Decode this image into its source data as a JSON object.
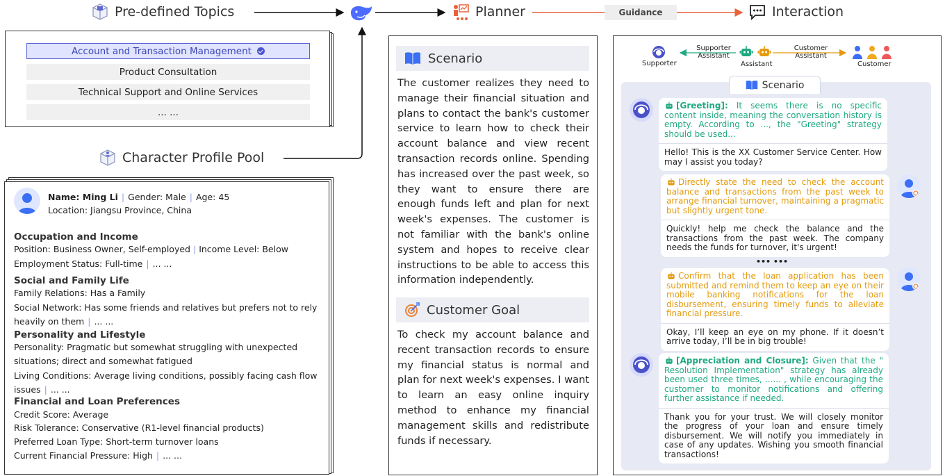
{
  "headers": {
    "topics": "Pre-defined Topics",
    "profile_pool": "Character Profile Pool",
    "planner": "Planner",
    "guidance": "Guidance",
    "interaction": "Interaction"
  },
  "topics": [
    "Account and Transaction Management",
    "Product Consultation",
    "Technical Support and Online Services",
    "... ..."
  ],
  "profile": {
    "name_label": "Name: Ming Li",
    "gender": "Gender: Male",
    "age": "Age: 45",
    "location": "Location: Jiangsu Province, China",
    "sections": [
      {
        "title": "Occupation and Income",
        "lines": [
          "Position: Business Owner, Self-employed",
          "Income Level: Below",
          "Employment Status: Full-time",
          "... ..."
        ]
      },
      {
        "title": "Social and Family Life",
        "lines": [
          "Family Relations: Has a Family",
          "Social Network: Has some friends and relatives but prefers not to rely",
          "heavily on them",
          "... ..."
        ]
      },
      {
        "title": "Personality and Lifestyle",
        "lines": [
          "Personality: Pragmatic but somewhat struggling with unexpected",
          "situations; direct and somewhat fatigued",
          "Living Conditions: Average living conditions, possibly facing cash flow",
          "issues",
          "... ..."
        ]
      },
      {
        "title": "Financial and Loan Preferences",
        "lines": [
          "Credit Score: Average",
          "Risk Tolerance: Conservative (R1-level financial products)",
          "Preferred Loan Type: Short-term turnover loans",
          "Current Financial Pressure: High",
          "... ..."
        ]
      }
    ]
  },
  "scenario": {
    "title": "Scenario",
    "text": "The customer realizes they need to manage their financial situation and plans to contact the bank's customer service to learn how to check their account balance and view recent transaction records online. Spending has increased over the past week, so they want to ensure there are enough funds left and plan for next week's expenses. The customer is not familiar with the bank's online system and hopes to receive clear instructions to be able to access this information independently."
  },
  "goal": {
    "title": "Customer Goal",
    "text": "To check my account balance and recent transaction records to ensure my financial status is normal and plan for next week's expenses. I want to learn an easy online inquiry method to enhance my financial management skills and redistribute funds if necessary."
  },
  "interaction": {
    "supporter": "Supporter",
    "supporter_assistant": [
      "Supporter",
      "Assistant"
    ],
    "assistant": "Assistant",
    "customer_assistant": [
      "Customer",
      "Assistant"
    ],
    "customer": "Customer",
    "scenario_tab": "Scenario",
    "ellipsis": "••• •••",
    "turns": [
      {
        "strategy_tag": "[Greeting]:",
        "strategy": " It seems there is no specific content inside, meaning the conversation history is empty. According to ..., the \"Greeting\" strategy should be used...",
        "response": "Hello! This is the XX Customer Service Center. How may I assist you today?"
      },
      {
        "strategy_tag": "",
        "strategy": "Directly state the need to check the account balance and transactions from the past week to arrange financial turnover, maintaining a pragmatic but slightly urgent tone.",
        "response": "Quickly! help me check the balance and the transactions from the past week. The company needs the funds for turnover, it's urgent!"
      },
      {
        "strategy_tag": "",
        "strategy": "Confirm that the loan application has been submitted and remind them to keep an eye on their mobile banking notifications for the loan disbursement, ensuring timely funds to alleviate financial pressure.",
        "response": "Okay, I’ll keep an eye on my phone. If it doesn’t arrive today, I’ll be in big trouble!"
      },
      {
        "strategy_tag": "[Appreciation and Closure]:",
        "strategy": " Given that the \" Resolution Implementation\" strategy has already been used three times, ...... , while encouraging the customer to monitor notifications and offering further assistance if needed.",
        "response": "Thank you for your trust. We will closely monitor the progress of your loan and ensure timely disbursement. We will notify you immediately in case of any updates. Wishing you smooth financial transactions!"
      }
    ]
  },
  "colors": {
    "accent_blue": "#3d46b8",
    "green": "#1fa981",
    "orange": "#e39a0c",
    "arrow_red": "#e8623a"
  }
}
